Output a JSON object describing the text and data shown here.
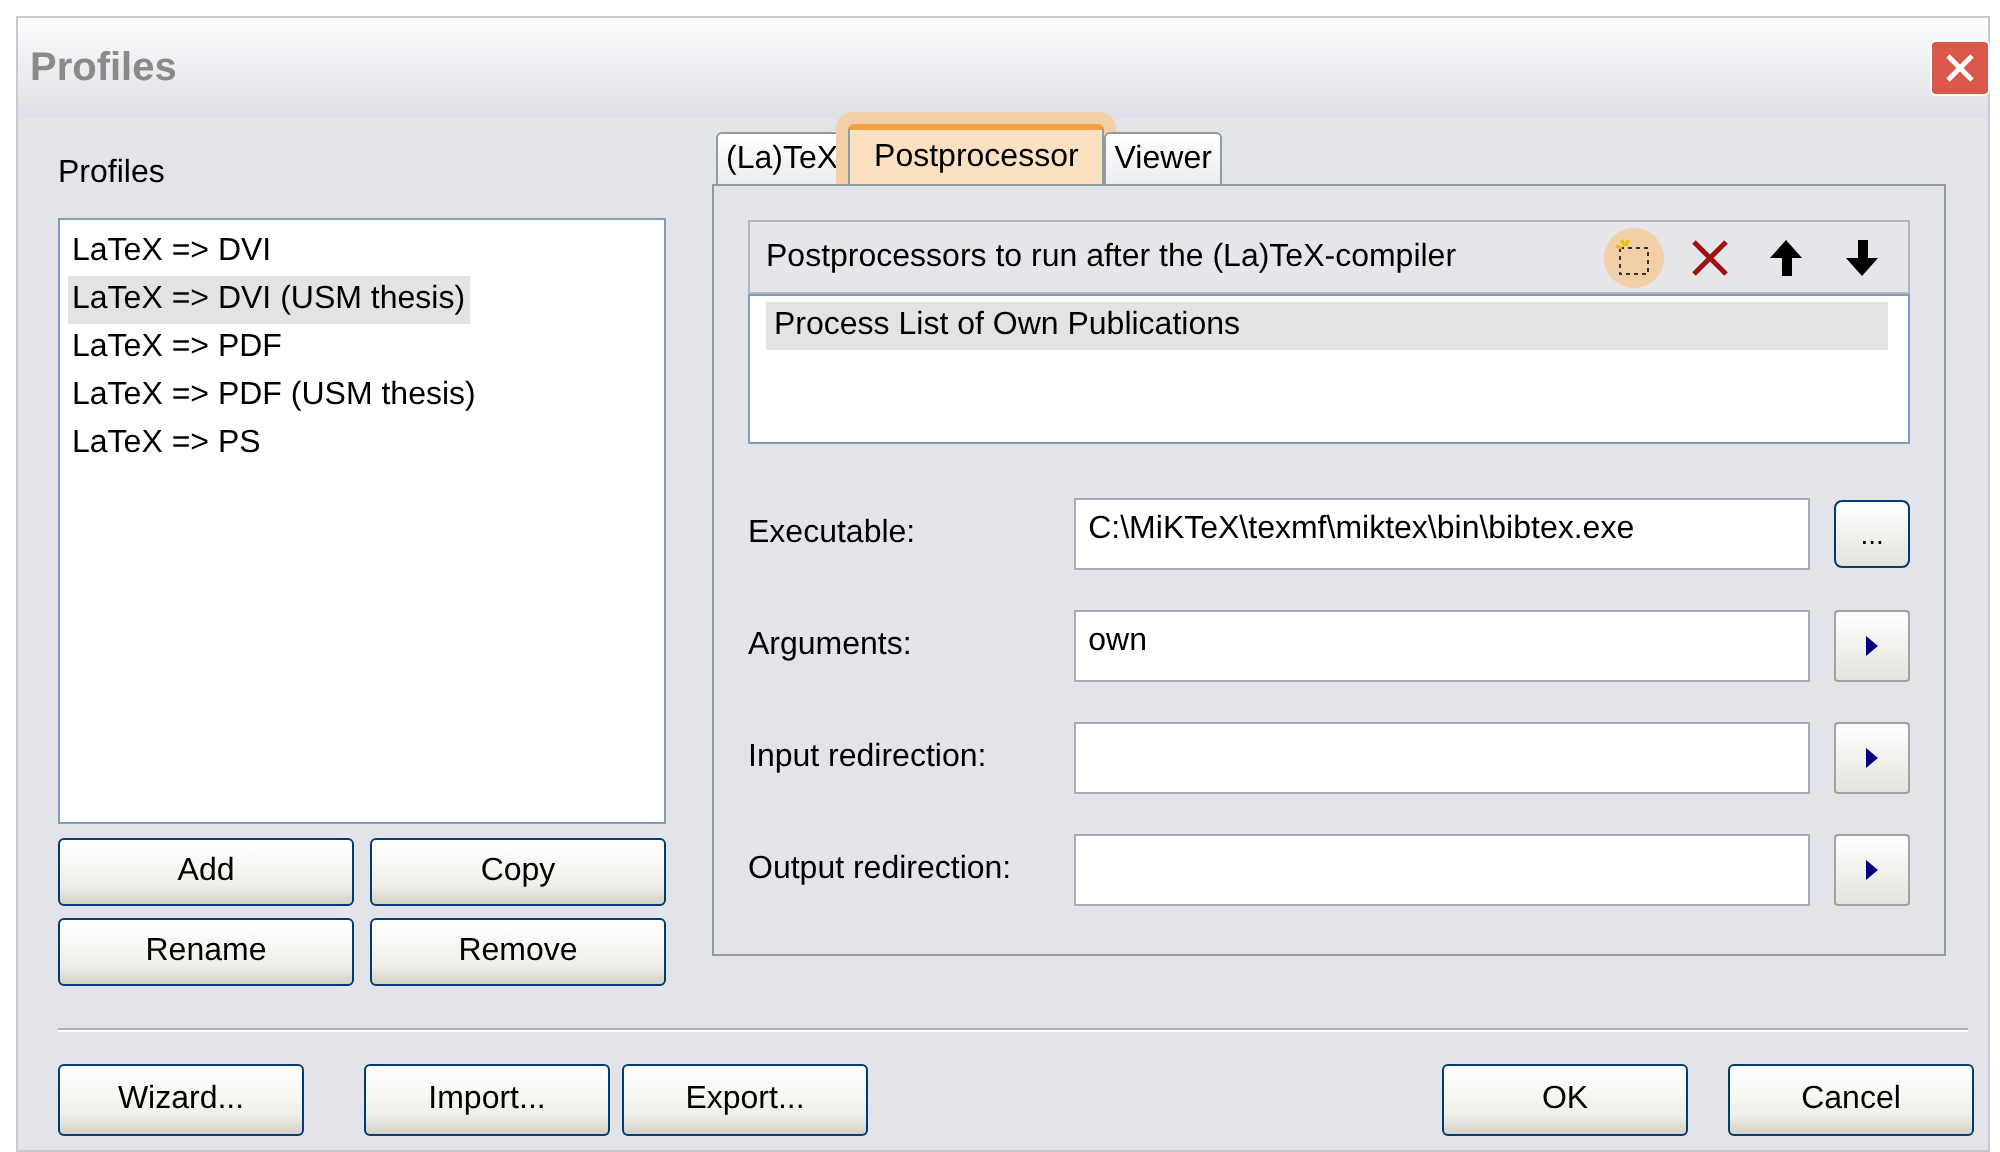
{
  "window": {
    "title": "Profiles"
  },
  "profiles": {
    "label": "Profiles",
    "items": [
      {
        "label": "LaTeX => DVI",
        "selected": false
      },
      {
        "label": "LaTeX => DVI (USM thesis)",
        "selected": true
      },
      {
        "label": "LaTeX => PDF",
        "selected": false
      },
      {
        "label": "LaTeX => PDF (USM thesis)",
        "selected": false
      },
      {
        "label": "LaTeX => PS",
        "selected": false
      }
    ],
    "buttons": [
      "Add",
      "Copy",
      "Rename",
      "Remove"
    ]
  },
  "tabs": [
    {
      "label": "(La)TeX",
      "selected": false,
      "highlighted": false
    },
    {
      "label": "Postprocessor",
      "selected": true,
      "highlighted": true
    },
    {
      "label": "Viewer",
      "selected": false,
      "highlighted": false
    }
  ],
  "postprocessors": {
    "header": "Postprocessors to run after the (La)TeX-compiler",
    "tools": [
      {
        "kind": "new",
        "highlighted": true
      },
      {
        "kind": "delete",
        "highlighted": false
      },
      {
        "kind": "up",
        "highlighted": false
      },
      {
        "kind": "down",
        "highlighted": false
      }
    ],
    "items": [
      {
        "label": "Process List of Own Publications",
        "selected": true
      }
    ]
  },
  "fields": [
    {
      "label": "Executable:",
      "value": "C:\\MiKTeX\\texmf\\miktex\\bin\\bibtex.exe",
      "kind": "browse",
      "button": "..."
    },
    {
      "label": "Arguments:",
      "value": "own",
      "kind": "menu"
    },
    {
      "label": "Input redirection:",
      "kind": "menu"
    },
    {
      "label": "Output redirection:",
      "kind": "menu"
    }
  ],
  "footer": {
    "left": [
      "Wizard...",
      "Import...",
      "Export..."
    ],
    "right": [
      "OK",
      "Cancel"
    ]
  }
}
